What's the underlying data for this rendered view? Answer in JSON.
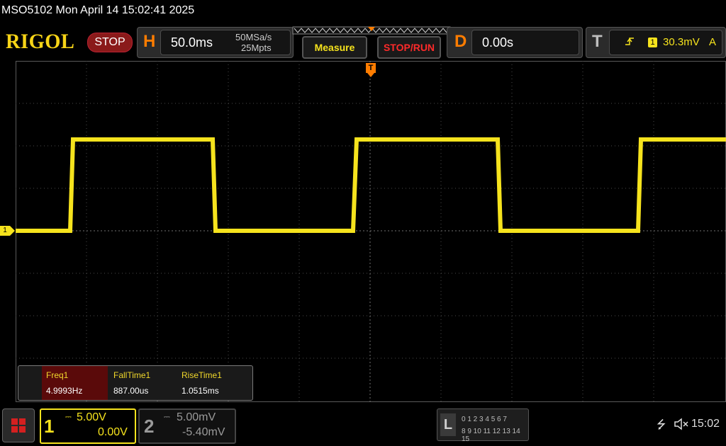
{
  "titlebar": {
    "text": "MSO5102  Mon April 14 15:02:41 2025"
  },
  "header": {
    "logo": "RIGOL",
    "run_state": "STOP",
    "horizontal": {
      "letter": "H",
      "timebase": "50.0ms",
      "sample_rate": "50MSa/s",
      "memory_depth": "25Mpts"
    },
    "measure_button": "Measure",
    "stop_run_button": "STOP/RUN",
    "delay": {
      "letter": "D",
      "value": "0.00s"
    },
    "trigger": {
      "letter": "T",
      "channel": "1",
      "level": "30.3mV",
      "mode": "A"
    }
  },
  "waveform": {
    "channel_marker": "1",
    "trigger_marker": "T",
    "color": "#f6e31d"
  },
  "measurements": [
    {
      "label": "Freq1",
      "value": "4.9993Hz"
    },
    {
      "label": "FallTime1",
      "value": "887.00us"
    },
    {
      "label": "RiseTime1",
      "value": "1.0515ms"
    }
  ],
  "footer": {
    "ch1": {
      "number": "1",
      "scale": "5.00V",
      "offset": "0.00V"
    },
    "ch2": {
      "number": "2",
      "scale": "5.00mV",
      "offset": "-5.40mV"
    },
    "logic": {
      "letter": "L",
      "row1": "0 1 2 3  4 5 6 7",
      "row2": "8  9 10 11  12 13 14 15"
    },
    "clock": "15:02"
  },
  "colors": {
    "accent_orange": "#ff7d00",
    "trace_yellow": "#f6e31d",
    "stop_red": "#8a1a1a",
    "error_red": "#ff2a2a"
  }
}
